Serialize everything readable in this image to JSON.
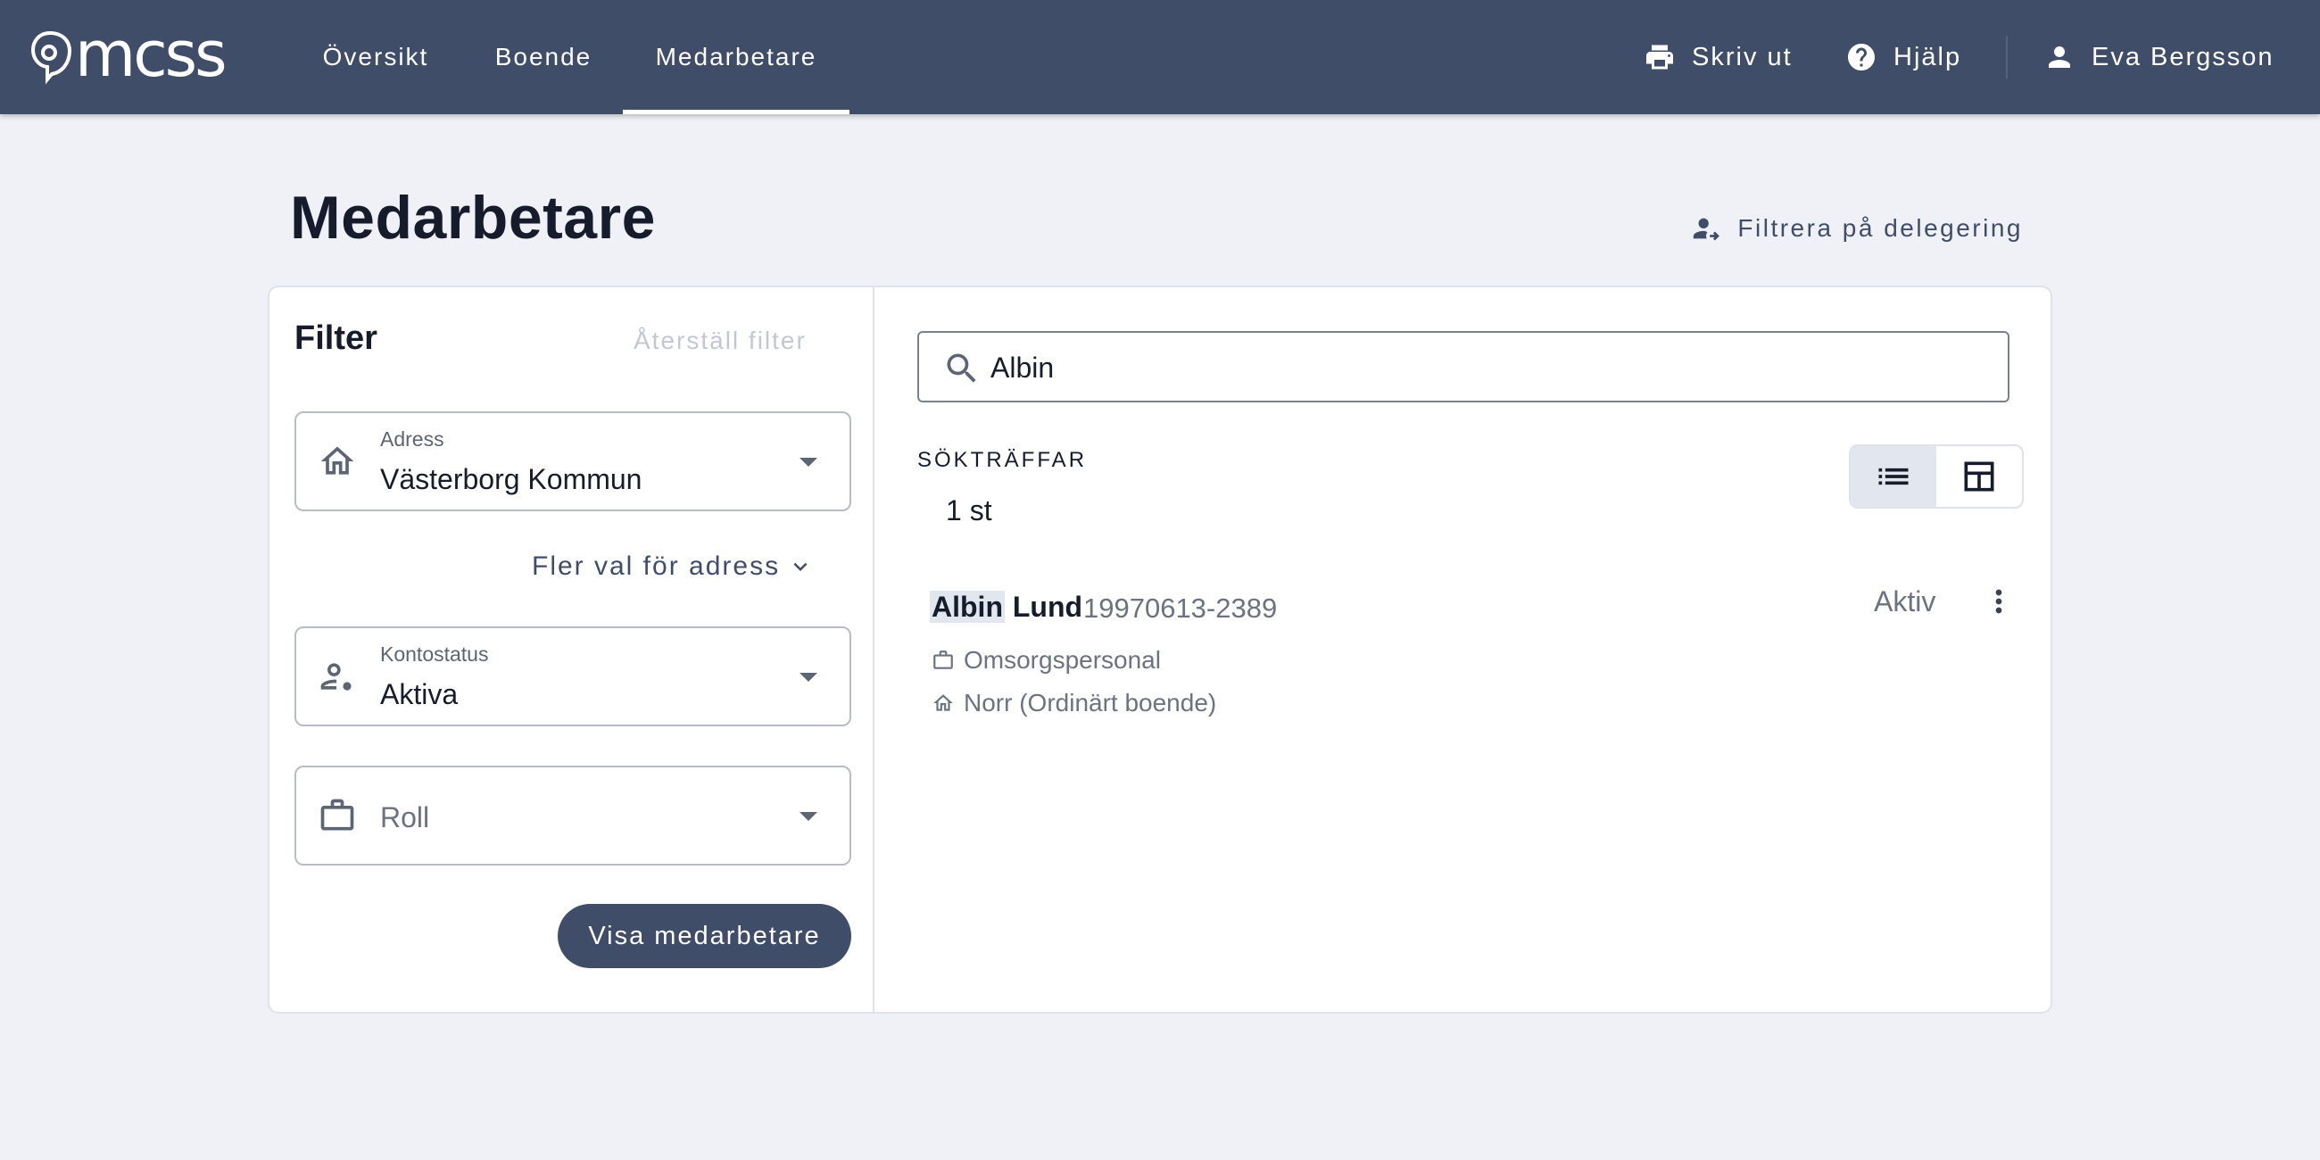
{
  "app": {
    "logo_text": "mcss"
  },
  "nav": {
    "items": [
      {
        "label": "Översikt"
      },
      {
        "label": "Boende"
      },
      {
        "label": "Medarbetare"
      }
    ],
    "active": "Medarbetare"
  },
  "top_actions": {
    "print_label": "Skriv ut",
    "help_label": "Hjälp",
    "user_name": "Eva Bergsson"
  },
  "page": {
    "title": "Medarbetare",
    "filter_delegation_label": "Filtrera på delegering"
  },
  "filter": {
    "title": "Filter",
    "reset_label": "Återställ filter",
    "address": {
      "label": "Adress",
      "value": "Västerborg Kommun",
      "icon": "home-icon"
    },
    "more_address_label": "Fler val för adress",
    "account_status": {
      "label": "Kontostatus",
      "value": "Aktiva",
      "icon": "person-status-icon"
    },
    "role": {
      "placeholder": "Roll",
      "icon": "briefcase-icon"
    },
    "show_button_label": "Visa medarbetare"
  },
  "search": {
    "value": "Albin",
    "placeholder": ""
  },
  "results": {
    "hits_label": "SÖKTRÄFFAR",
    "hits_count": "1 st",
    "view_modes": [
      "list",
      "table"
    ],
    "active_view": "list",
    "items": [
      {
        "first_name": "Albin",
        "last_name": "Lund",
        "person_id": "19970613-2389",
        "status": "Aktiv",
        "role": "Omsorgspersonal",
        "residence": "Norr (Ordinärt boende)"
      }
    ]
  },
  "colors": {
    "topbar": "#3f4d68",
    "background": "#f0f1f6",
    "primary": "#3f4d68",
    "highlight": "#e2e6ef"
  }
}
